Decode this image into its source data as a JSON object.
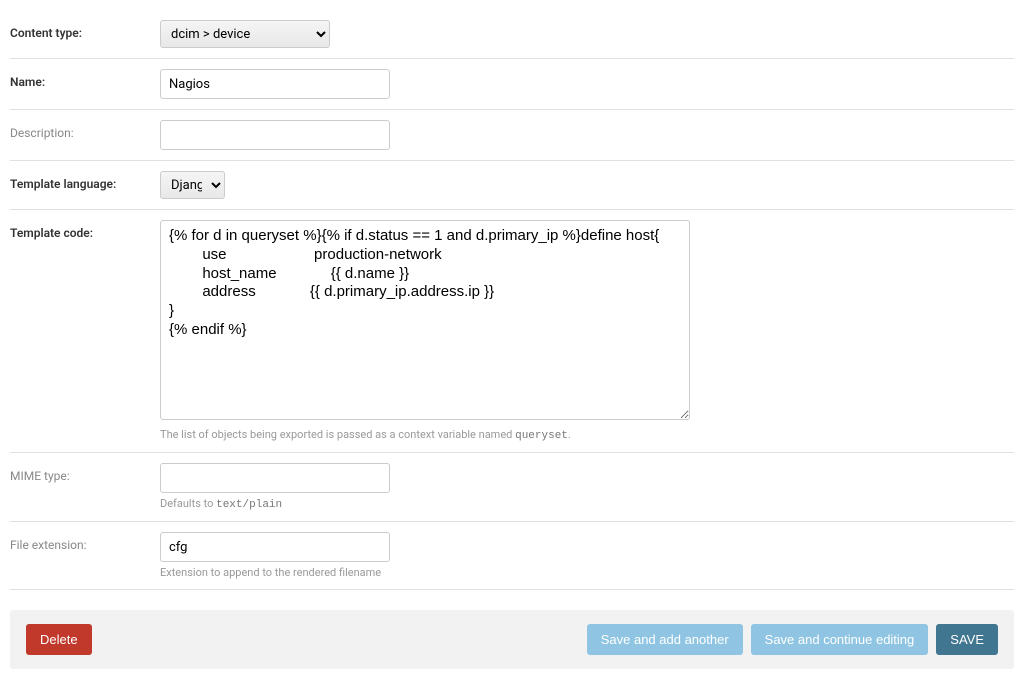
{
  "fields": {
    "content_type": {
      "label": "Content type:",
      "value": "dcim > device"
    },
    "name": {
      "label": "Name:",
      "value": "Nagios"
    },
    "description": {
      "label": "Description:",
      "value": ""
    },
    "template_language": {
      "label": "Template language:",
      "value": "Django"
    },
    "template_code": {
      "label": "Template code:",
      "value": "{% for d in queryset %}{% if d.status == 1 and d.primary_ip %}define host{\n        use                     production-network\n        host_name             {{ d.name }}\n        address             {{ d.primary_ip.address.ip }}\n}\n{% endif %}",
      "help_pre": "The list of objects being exported is passed as a context variable named ",
      "help_code": "queryset",
      "help_post": "."
    },
    "mime_type": {
      "label": "MIME type:",
      "value": "",
      "help_pre": "Defaults to ",
      "help_code": "text/plain"
    },
    "file_extension": {
      "label": "File extension:",
      "value": "cfg",
      "help": "Extension to append to the rendered filename"
    }
  },
  "buttons": {
    "delete": "Delete",
    "save_add": "Save and add another",
    "save_continue": "Save and continue editing",
    "save": "SAVE"
  }
}
